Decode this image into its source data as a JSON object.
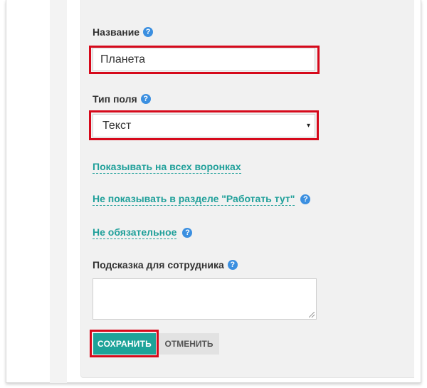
{
  "form": {
    "name_label": "Название",
    "name_value": "Планета",
    "field_type_label": "Тип поля",
    "field_type_value": "Текст",
    "show_all_funnels_link": "Показывать на всех воронках",
    "hide_work_here_link": "Не показывать в разделе \"Работать тут\"",
    "optional_link": "Не обязательное",
    "hint_label": "Подсказка для сотрудника",
    "hint_value": "",
    "help_glyph": "?",
    "select_arrow": "▾"
  },
  "buttons": {
    "save": "Сохранить",
    "cancel": "Отменить"
  },
  "colors": {
    "accent": "#1ea399",
    "link": "#20a09a",
    "highlight": "#d6091b",
    "help_icon": "#3b8fe0"
  },
  "icons": {
    "help": "question-circle-icon",
    "dropdown": "caret-down-icon",
    "resize": "resize-grip-icon"
  }
}
